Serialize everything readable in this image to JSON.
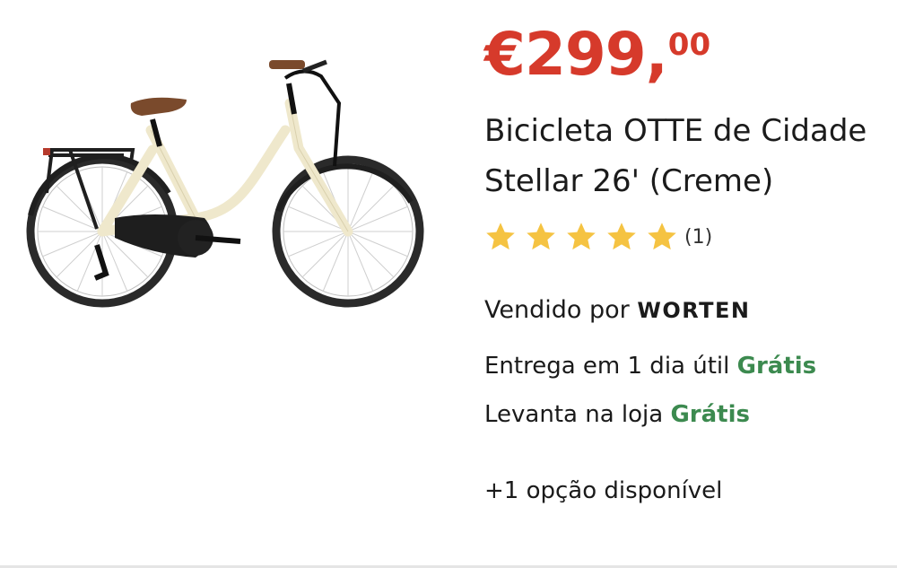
{
  "product": {
    "price": {
      "currency": "€",
      "integer": "299",
      "comma": ",",
      "cents": "00"
    },
    "title": "Bicicleta OTTE de Cidade Stellar 26' (Creme)",
    "rating": {
      "stars": 5,
      "max": 5,
      "count_label": "(1)"
    },
    "seller": {
      "prefix": "Vendido por",
      "name": "WORTEN"
    },
    "delivery": {
      "text": "Entrega em 1 dia útil",
      "cost": "Grátis"
    },
    "pickup": {
      "text": "Levanta na loja",
      "cost": "Grátis"
    },
    "options": "+1 opção disponível"
  },
  "colors": {
    "price": "#d63a2b",
    "free": "#3c8a4f",
    "star": "#f5c342",
    "frame": "#efe8cc"
  },
  "icons": {
    "star": "star-icon",
    "image": "bicycle-image"
  }
}
